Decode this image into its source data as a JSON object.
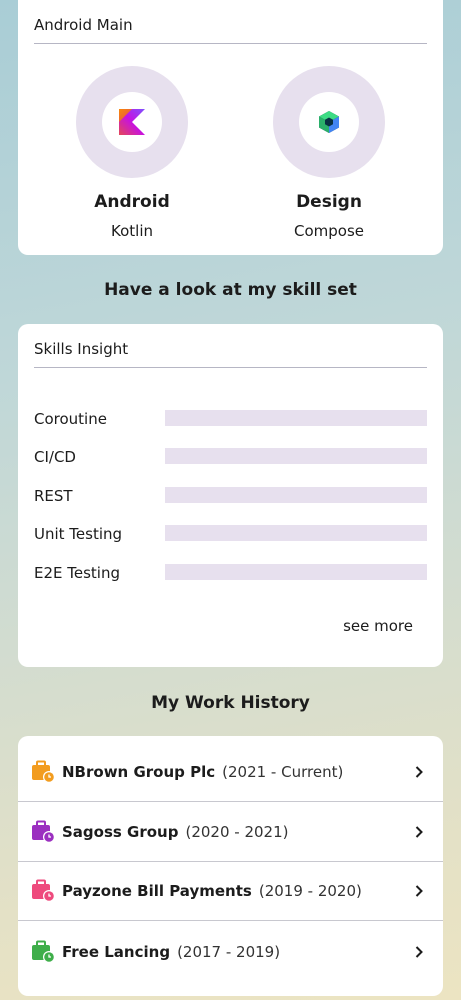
{
  "main_card": {
    "title": "Android Main",
    "items": [
      {
        "title": "Android",
        "subtitle": "Kotlin",
        "icon": "kotlin-logo-icon"
      },
      {
        "title": "Design",
        "subtitle": "Compose",
        "icon": "jetpack-compose-logo-icon"
      }
    ]
  },
  "skills_heading": "Have a look at my skill set",
  "skills_card": {
    "title": "Skills Insight",
    "skills": [
      {
        "label": "Coroutine",
        "level": 0
      },
      {
        "label": "CI/CD",
        "level": 0
      },
      {
        "label": "REST",
        "level": 0
      },
      {
        "label": "Unit Testing",
        "level": 0
      },
      {
        "label": "E2E Testing",
        "level": 0
      }
    ],
    "see_more": "see more"
  },
  "work_heading": "My Work History",
  "work_history": [
    {
      "company": "NBrown Group Plc",
      "period": "(2021 - Current)",
      "color": "#f29c1f"
    },
    {
      "company": "Sagoss Group",
      "period": "(2020 - 2021)",
      "color": "#9b2fc0"
    },
    {
      "company": "Payzone Bill Payments",
      "period": "(2019 - 2020)",
      "color": "#ee4a7d"
    },
    {
      "company": "Free Lancing",
      "period": "(2017 - 2019)",
      "color": "#3fae4a"
    }
  ],
  "colors": {
    "ring": "#e7e0ee",
    "skill_bar": "#e7e0ee"
  }
}
